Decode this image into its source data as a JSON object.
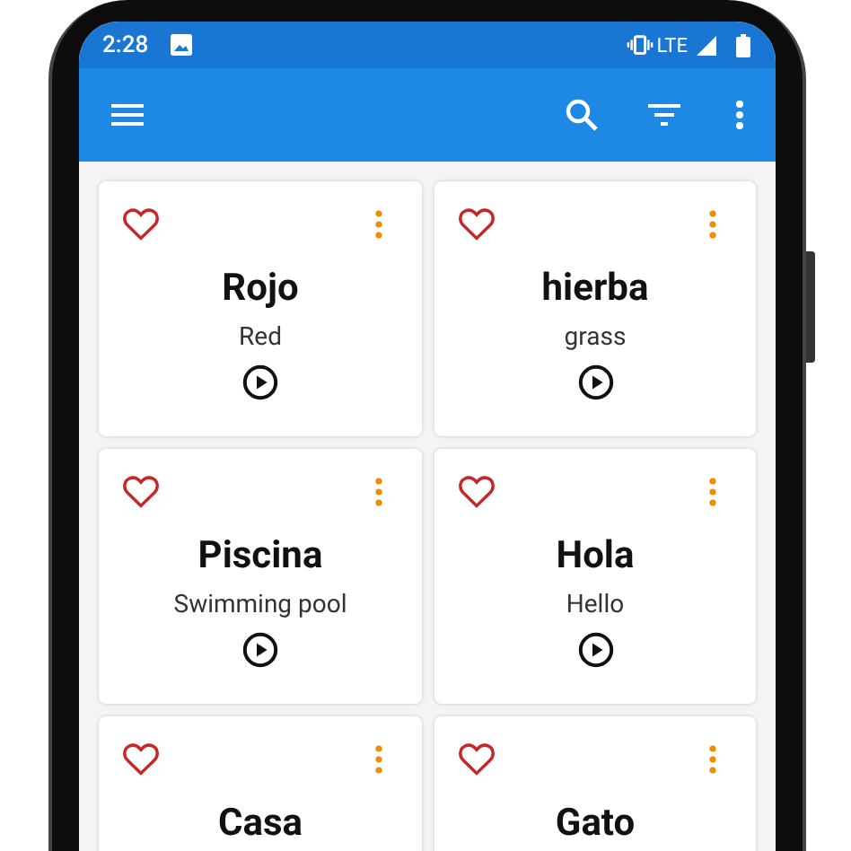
{
  "status_bar": {
    "time": "2:28",
    "network": "LTE"
  },
  "cards": [
    {
      "word": "Rojo",
      "translation": "Red",
      "favorite": false
    },
    {
      "word": "hierba",
      "translation": "grass",
      "favorite": false
    },
    {
      "word": "Piscina",
      "translation": "Swimming pool",
      "favorite": false
    },
    {
      "word": "Hola",
      "translation": "Hello",
      "favorite": false
    },
    {
      "word": "Casa",
      "favorite": false
    },
    {
      "word": "Gato",
      "favorite": false
    }
  ]
}
